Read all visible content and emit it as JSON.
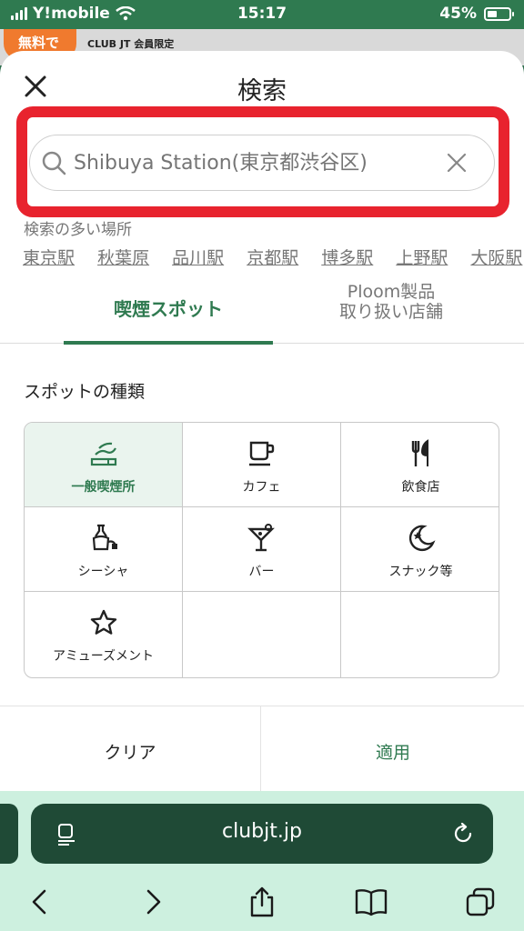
{
  "status_bar": {
    "carrier": "Y!mobile",
    "time": "15:17",
    "battery": "45%",
    "battery_level": 0.45
  },
  "background_page": {
    "badge": "無料で",
    "club_text": "CLUB JT 会員限定"
  },
  "sheet": {
    "title": "検索",
    "search": {
      "placeholder": "Shibuya Station(東京都渋谷区)",
      "value": ""
    },
    "popular_label": "検索の多い場所",
    "popular_places": [
      "東京駅",
      "秋葉原",
      "品川駅",
      "京都駅",
      "博多駅",
      "上野駅",
      "大阪駅"
    ],
    "tabs": [
      {
        "label": "喫煙スポット",
        "active": true
      },
      {
        "label_line1": "Ploom製品",
        "label_line2": "取り扱い店舗",
        "active": false
      }
    ],
    "section_title": "スポットの種類",
    "spot_types": [
      {
        "label": "一般喫煙所",
        "icon": "smoking-icon",
        "selected": true
      },
      {
        "label": "カフェ",
        "icon": "coffee-cup-icon",
        "selected": false
      },
      {
        "label": "飲食店",
        "icon": "fork-knife-icon",
        "selected": false
      },
      {
        "label": "シーシャ",
        "icon": "shisha-icon",
        "selected": false
      },
      {
        "label": "バー",
        "icon": "cocktail-icon",
        "selected": false
      },
      {
        "label": "スナック等",
        "icon": "moon-star-icon",
        "selected": false
      },
      {
        "label": "アミューズメント",
        "icon": "star-icon",
        "selected": false
      }
    ],
    "buttons": {
      "clear": "クリア",
      "apply": "適用"
    }
  },
  "browser": {
    "url": "clubjt.jp"
  },
  "colors": {
    "accent": "#2f7a50",
    "highlight": "#e8232e",
    "browser_bg": "#cdf0df"
  }
}
